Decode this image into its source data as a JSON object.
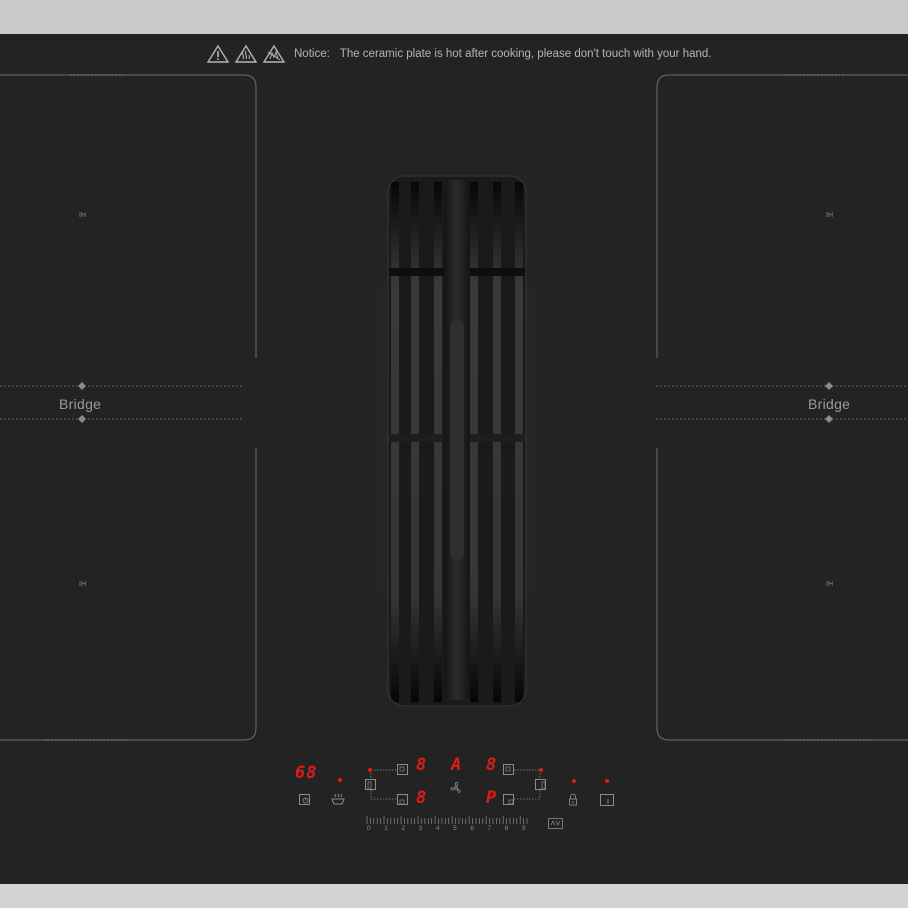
{
  "notice": {
    "label": "Notice:",
    "text": "The ceramic plate is hot after cooking, please don't touch with your hand."
  },
  "zones": {
    "left_bridge_label": "Bridge",
    "right_bridge_label": "Bridge",
    "ih_mark": "IH"
  },
  "display": {
    "timer_readout": "68",
    "left_front": "8",
    "left_rear": "8",
    "center": "A",
    "right_front": "8",
    "right_rear": "P"
  },
  "slider": {
    "numbers": [
      "0",
      "1",
      "2",
      "3",
      "4",
      "5",
      "6",
      "7",
      "8",
      "9"
    ]
  },
  "icons": [
    "warning-triangle-icon",
    "hot-surface-icon",
    "no-touch-icon",
    "timer-icon",
    "keep-warm-icon",
    "fan-icon",
    "lock-icon",
    "power-icon",
    "boost-icon"
  ],
  "colors": {
    "plate": "#232323",
    "frame": "#c9cacc",
    "display_red": "#e01a1a",
    "markings": "#8b8b8b"
  }
}
